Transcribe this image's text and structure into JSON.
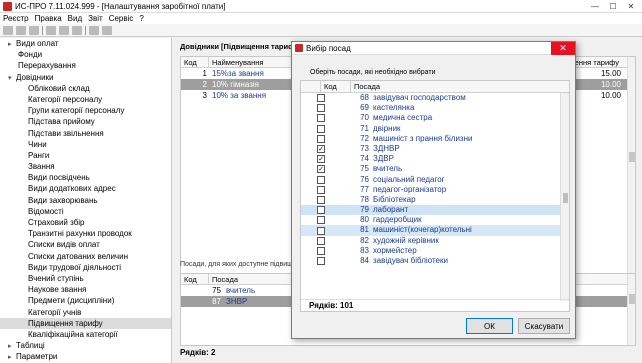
{
  "window": {
    "title": "ИС-ПРО 7.11.024.999 - [Налаштування заробітної плати]"
  },
  "menu": [
    "Реєстр",
    "Правка",
    "Вид",
    "Звіт",
    "Сервіс",
    "?"
  ],
  "tree": [
    {
      "label": "Види оплат",
      "level": 0,
      "exp": "▸"
    },
    {
      "label": "Фонди",
      "level": 0,
      "exp": ""
    },
    {
      "label": "Перерахування",
      "level": 0,
      "exp": ""
    },
    {
      "label": "Довідники",
      "level": 0,
      "exp": "▾"
    },
    {
      "label": "Обліковий склад",
      "level": 1
    },
    {
      "label": "Категорії персоналу",
      "level": 1
    },
    {
      "label": "Групи категорії персоналу",
      "level": 1
    },
    {
      "label": "Підстава прийому",
      "level": 1
    },
    {
      "label": "Підстави звільнення",
      "level": 1
    },
    {
      "label": "Чини",
      "level": 1
    },
    {
      "label": "Ранги",
      "level": 1
    },
    {
      "label": "Звання",
      "level": 1
    },
    {
      "label": "Види посвідчень",
      "level": 1
    },
    {
      "label": "Види додаткових адрес",
      "level": 1
    },
    {
      "label": "Види захворювань",
      "level": 1
    },
    {
      "label": "Відомості",
      "level": 1
    },
    {
      "label": "Страховий збір",
      "level": 1
    },
    {
      "label": "Транзитні рахунки проводок",
      "level": 1
    },
    {
      "label": "Списки видів оплат",
      "level": 1
    },
    {
      "label": "Списки датованих величин",
      "level": 1
    },
    {
      "label": "Види трудової діяльності",
      "level": 1
    },
    {
      "label": "Вчений ступінь",
      "level": 1
    },
    {
      "label": "Наукове звання",
      "level": 1
    },
    {
      "label": "Предмети (дисципліни)",
      "level": 1
    },
    {
      "label": "Категорії учнів",
      "level": 1
    },
    {
      "label": "Підвищення тарифу",
      "level": 1,
      "selected": true
    },
    {
      "label": "Кваліфікаційна категорії",
      "level": 1
    },
    {
      "label": "Таблиці",
      "level": 0,
      "exp": "▸"
    },
    {
      "label": "Параметри",
      "level": 0,
      "exp": "▸"
    }
  ],
  "main": {
    "section_title": "Довідники [Підвищення тарифу]",
    "columns": {
      "kod": "Код",
      "name": "Найменування",
      "rate": "підвищення тарифу"
    },
    "rows": [
      {
        "kod": "1",
        "name": "15%за звання",
        "rate": "15.00"
      },
      {
        "kod": "2",
        "name": "10% гімназія",
        "rate": "10.00",
        "selected": true
      },
      {
        "kod": "3",
        "name": "10% за звання",
        "rate": "10.00"
      }
    ],
    "bottom_title": "Посади, для яких доступне підвищення тарифу",
    "bottom_columns": {
      "kod": "Код",
      "name": "Посада"
    },
    "bottom_rows": [
      {
        "kod": "75",
        "name": "вчитель"
      },
      {
        "kod": "87",
        "name": "ЗНВР",
        "selected": true
      }
    ],
    "footer": "Рядків: 2"
  },
  "dialog": {
    "title": "Вибір посад",
    "prompt": "Оберіть посади, які необхідно вибрати",
    "columns": {
      "kod": "Код",
      "pos": "Посада"
    },
    "rows": [
      {
        "kod": "68",
        "pos": "завідувач господарством",
        "checked": false
      },
      {
        "kod": "69",
        "pos": "кастелянка",
        "checked": false
      },
      {
        "kod": "70",
        "pos": "медична сестра",
        "checked": false
      },
      {
        "kod": "71",
        "pos": "двірник",
        "checked": false
      },
      {
        "kod": "72",
        "pos": "машиніст з прання білизни",
        "checked": false
      },
      {
        "kod": "73",
        "pos": "ЗДНВР",
        "checked": true
      },
      {
        "kod": "74",
        "pos": "ЗДВР",
        "checked": true
      },
      {
        "kod": "75",
        "pos": "вчитель",
        "checked": true
      },
      {
        "kod": "76",
        "pos": "соціальний педагог",
        "checked": false
      },
      {
        "kod": "77",
        "pos": "педагог-організатор",
        "checked": false
      },
      {
        "kod": "78",
        "pos": "Бібліотекар",
        "checked": false
      },
      {
        "kod": "79",
        "pos": "лаборант",
        "checked": false,
        "current": true
      },
      {
        "kod": "80",
        "pos": "гардеробщик",
        "checked": false
      },
      {
        "kod": "81",
        "pos": "машиніст(кочегар)котельні",
        "checked": false,
        "hl": true
      },
      {
        "kod": "82",
        "pos": "художній керівник",
        "checked": false
      },
      {
        "kod": "83",
        "pos": "хормейстер",
        "checked": false
      },
      {
        "kod": "84",
        "pos": "завідувач бібліотеки",
        "checked": false
      }
    ],
    "footer": "Рядків: 101",
    "ok_label": "ОК",
    "cancel_label": "Скасувати"
  }
}
